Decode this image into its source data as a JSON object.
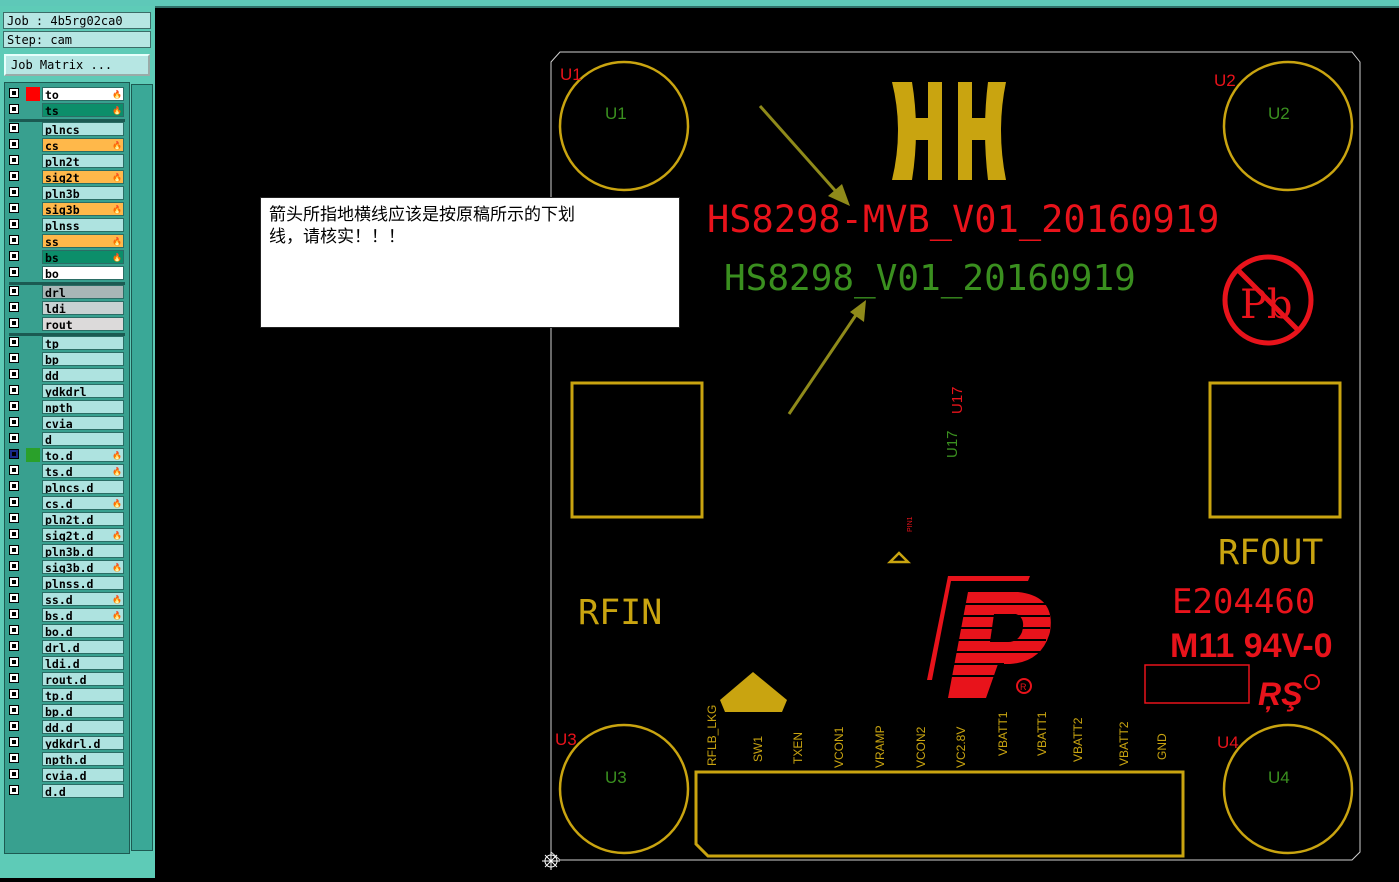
{
  "job": {
    "label": "Job : 4b5rg02ca0"
  },
  "step": {
    "label": "Step: cam"
  },
  "job_matrix_button": "Job Matrix ...",
  "layers": [
    {
      "name": "to",
      "bg": "#ffffff",
      "swatch": "#ff0000",
      "flame": true
    },
    {
      "name": "ts",
      "bg": "#0c8e6a",
      "swatch": "",
      "flame": true
    },
    {
      "name": "plncs",
      "bg": "#aee3e0",
      "swatch": "",
      "flame": false
    },
    {
      "name": "cs",
      "bg": "#ffb84a",
      "swatch": "",
      "flame": true
    },
    {
      "name": "pln2t",
      "bg": "#aee3e0",
      "swatch": "",
      "flame": false
    },
    {
      "name": "sig2t",
      "bg": "#ffb84a",
      "swatch": "",
      "flame": true
    },
    {
      "name": "pln3b",
      "bg": "#aee3e0",
      "swatch": "",
      "flame": false
    },
    {
      "name": "sig3b",
      "bg": "#ffb84a",
      "swatch": "",
      "flame": true
    },
    {
      "name": "plnss",
      "bg": "#aee3e0",
      "swatch": "",
      "flame": false
    },
    {
      "name": "ss",
      "bg": "#ffb84a",
      "swatch": "",
      "flame": true
    },
    {
      "name": "bs",
      "bg": "#0c8e6a",
      "swatch": "",
      "flame": true
    },
    {
      "name": "bo",
      "bg": "#ffffff",
      "swatch": "",
      "flame": false
    },
    {
      "name": "drl",
      "bg": "#a8b6b6",
      "swatch": "",
      "flame": false
    },
    {
      "name": "ldi",
      "bg": "#c8d2d2",
      "swatch": "",
      "flame": false
    },
    {
      "name": "rout",
      "bg": "#dcdada",
      "swatch": "",
      "flame": false
    },
    {
      "name": "tp",
      "bg": "#aee3e0",
      "swatch": "",
      "flame": false
    },
    {
      "name": "bp",
      "bg": "#aee3e0",
      "swatch": "",
      "flame": false
    },
    {
      "name": "dd",
      "bg": "#aee3e0",
      "swatch": "",
      "flame": false
    },
    {
      "name": "ydkdrl",
      "bg": "#aee3e0",
      "swatch": "",
      "flame": false
    },
    {
      "name": "npth",
      "bg": "#aee3e0",
      "swatch": "",
      "flame": false
    },
    {
      "name": "cvia",
      "bg": "#aee3e0",
      "swatch": "",
      "flame": false
    },
    {
      "name": "d",
      "bg": "#aee3e0",
      "swatch": "",
      "flame": false
    },
    {
      "name": "to.d",
      "bg": "#aee3e0",
      "swatch": "#2aa02a",
      "flame": true,
      "selected": true
    },
    {
      "name": "ts.d",
      "bg": "#aee3e0",
      "swatch": "",
      "flame": true
    },
    {
      "name": "plncs.d",
      "bg": "#aee3e0",
      "swatch": "",
      "flame": false
    },
    {
      "name": "cs.d",
      "bg": "#aee3e0",
      "swatch": "",
      "flame": true
    },
    {
      "name": "pln2t.d",
      "bg": "#aee3e0",
      "swatch": "",
      "flame": false
    },
    {
      "name": "sig2t.d",
      "bg": "#aee3e0",
      "swatch": "",
      "flame": true
    },
    {
      "name": "pln3b.d",
      "bg": "#aee3e0",
      "swatch": "",
      "flame": false
    },
    {
      "name": "sig3b.d",
      "bg": "#aee3e0",
      "swatch": "",
      "flame": true
    },
    {
      "name": "plnss.d",
      "bg": "#aee3e0",
      "swatch": "",
      "flame": false
    },
    {
      "name": "ss.d",
      "bg": "#aee3e0",
      "swatch": "",
      "flame": true
    },
    {
      "name": "bs.d",
      "bg": "#aee3e0",
      "swatch": "",
      "flame": true
    },
    {
      "name": "bo.d",
      "bg": "#aee3e0",
      "swatch": "",
      "flame": false
    },
    {
      "name": "drl.d",
      "bg": "#aee3e0",
      "swatch": "",
      "flame": false
    },
    {
      "name": "ldi.d",
      "bg": "#aee3e0",
      "swatch": "",
      "flame": false
    },
    {
      "name": "rout.d",
      "bg": "#aee3e0",
      "swatch": "",
      "flame": false
    },
    {
      "name": "tp.d",
      "bg": "#aee3e0",
      "swatch": "",
      "flame": false
    },
    {
      "name": "bp.d",
      "bg": "#aee3e0",
      "swatch": "",
      "flame": false
    },
    {
      "name": "dd.d",
      "bg": "#aee3e0",
      "swatch": "",
      "flame": false
    },
    {
      "name": "ydkdrl.d",
      "bg": "#aee3e0",
      "swatch": "",
      "flame": false
    },
    {
      "name": "npth.d",
      "bg": "#aee3e0",
      "swatch": "",
      "flame": false
    },
    {
      "name": "cvia.d",
      "bg": "#aee3e0",
      "swatch": "",
      "flame": false
    },
    {
      "name": "d.d",
      "bg": "#aee3e0",
      "swatch": "",
      "flame": false
    }
  ],
  "comment": {
    "line1": "箭头所指地横线应该是按原稿所示的下划",
    "line2": "线，请核实！！！"
  },
  "board": {
    "title_red": "HS8298-MVB_V01_20160919",
    "title_green": "HS8298_V01_20160919",
    "u1_red": "U1",
    "u1_green": "U1",
    "u2_red": "U2",
    "u2_green": "U2",
    "u3_red": "U3",
    "u3_green": "U3",
    "u4_red": "U4",
    "u4_green": "U4",
    "u17_red": "U17",
    "u17_green": "U17",
    "pin1": "PIN1",
    "pb": "Pb",
    "rfout": "RFOUT",
    "rfin": "RFIN",
    "e_number": "E204460",
    "m11": "M11 94V-0",
    "registered": "®",
    "pins": [
      "RFLB_LKG",
      "SW1",
      "TXEN",
      "VCON1",
      "VRAMP",
      "VCON2",
      "VC2.8V",
      "VBATT1",
      "VBATT1",
      "VBATT2",
      "VBATT2",
      "GND"
    ]
  },
  "colors": {
    "gold": "#c9a410",
    "red": "#e8131b",
    "green": "#3a8f1f",
    "arrow": "#8f8a1a",
    "outline": "#d0d0d0"
  }
}
